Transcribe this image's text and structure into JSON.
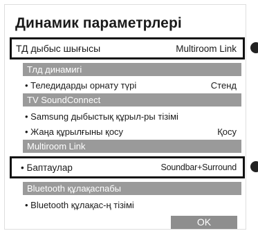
{
  "page": {
    "title": "Динамик параметрлері"
  },
  "tv_audio_output": {
    "label": "ТД дыбыс шығысы",
    "value": "Multiroom Link"
  },
  "sections": {
    "tv_speaker": "Тлд динамигі",
    "tv_soundconnect": "TV SoundConnect",
    "multiroom_link": "Multiroom Link",
    "bluetooth_headphones": "Bluetooth құлақаспабы"
  },
  "items": {
    "tv_installation_type": {
      "label": "• Теледидарды орнату түрі",
      "value": "Стенд"
    },
    "samsung_device_list": {
      "label": "• Samsung дыбыстық құрыл-ры тізімі"
    },
    "add_new_device": {
      "label": "• Жаңа құрылғыны қосу",
      "value": "Қосу"
    },
    "bluetooth_list": {
      "label": "• Bluetooth құлақас-ң тізімі"
    }
  },
  "settings_row": {
    "label": "• Баптаулар",
    "value": "Soundbar+Surround"
  },
  "ok_button": "OK",
  "colors": {
    "highlight_border": "#111111",
    "section_header_bg": "#9a9a9a",
    "ok_button_bg": "#8e8e8e"
  }
}
